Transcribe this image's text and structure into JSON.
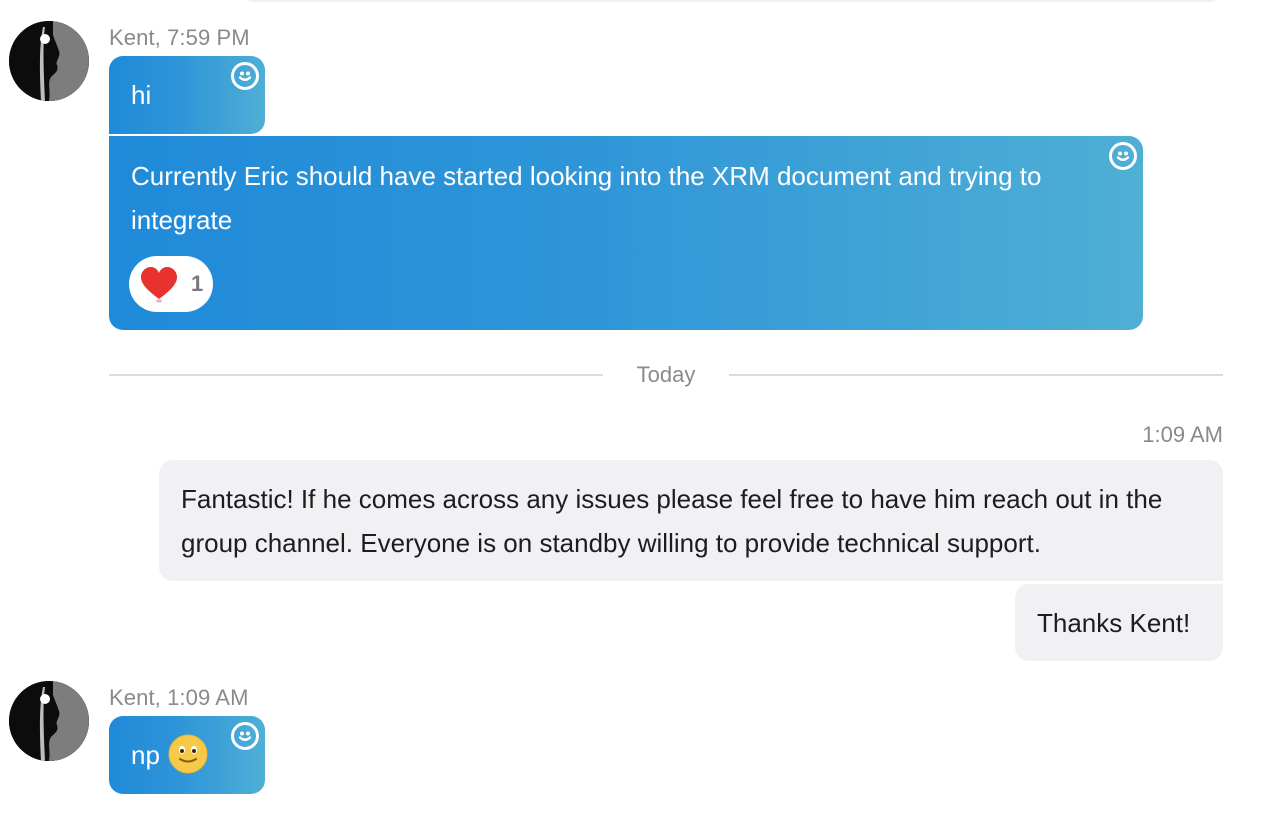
{
  "messages": {
    "group1": {
      "sender": "Kent, 7:59 PM",
      "msg1": "hi",
      "msg2": "Currently Eric should have started looking into the XRM document and trying to integrate",
      "msg2_reaction": {
        "emoji": "heart",
        "count": "1"
      }
    },
    "divider": "Today",
    "outgoing": {
      "time": "1:09 AM",
      "msg1": "Fantastic! If he comes across any issues please feel free to have him reach out in the group channel. Everyone is on standby willing to provide technical support.",
      "msg2": "Thanks Kent!"
    },
    "group2": {
      "sender": "Kent, 1:09 AM",
      "msg1": "np",
      "msg1_emoji": "slightly-smiling-face"
    }
  },
  "colors": {
    "incoming_gradient_start": "#1f8ad9",
    "incoming_gradient_end": "#4fafd5",
    "outgoing_bubble": "#f1f1f3",
    "meta_text": "#8a8a8e",
    "heart": "#e8322f",
    "smiley": "#f7c948"
  },
  "icons": {
    "react_button": "add-reaction-icon",
    "avatar": "kent-avatar"
  }
}
